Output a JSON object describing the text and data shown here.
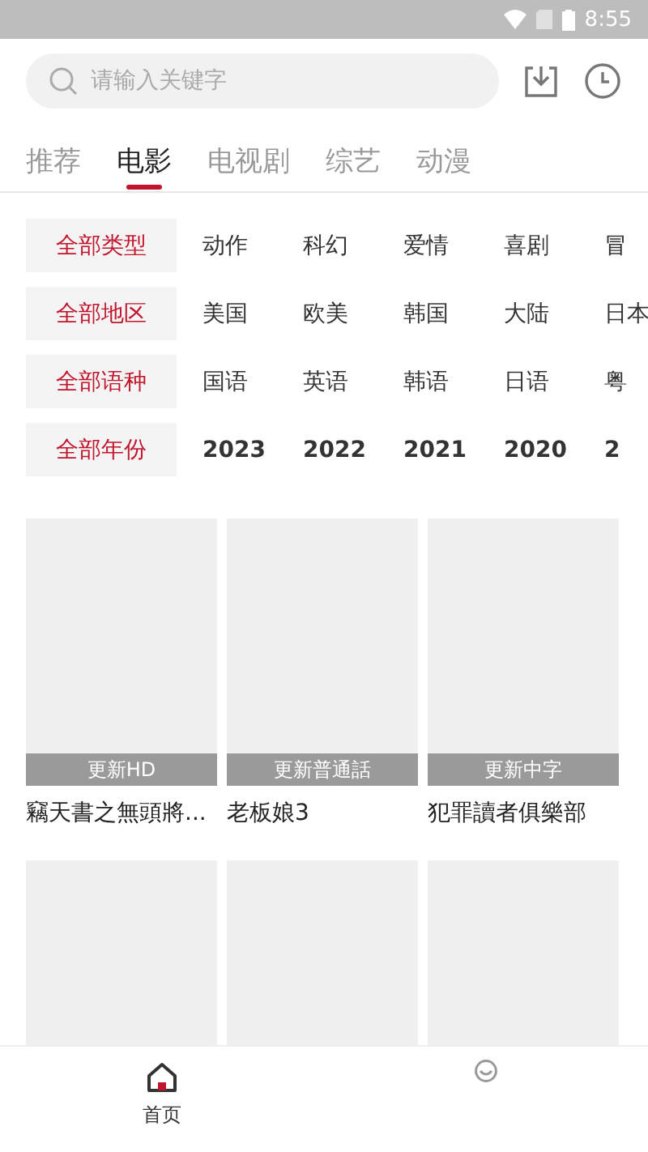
{
  "status_bar": {
    "time": "8:55"
  },
  "search": {
    "placeholder": "请输入关键字"
  },
  "tabs": [
    {
      "label": "推荐",
      "selected": false
    },
    {
      "label": "电影",
      "selected": true
    },
    {
      "label": "电视剧",
      "selected": false
    },
    {
      "label": "综艺",
      "selected": false
    },
    {
      "label": "动漫",
      "selected": false
    }
  ],
  "filters": [
    {
      "label": "全部类型",
      "options": [
        "动作",
        "科幻",
        "爱情",
        "喜剧",
        "冒"
      ]
    },
    {
      "label": "全部地区",
      "options": [
        "美国",
        "欧美",
        "韩国",
        "大陆",
        "日本"
      ]
    },
    {
      "label": "全部语种",
      "options": [
        "国语",
        "英语",
        "韩语",
        "日语",
        "粤"
      ]
    },
    {
      "label": "全部年份",
      "options": [
        "2023",
        "2022",
        "2021",
        "2020",
        "2"
      ]
    }
  ],
  "movies": [
    {
      "kind": "movie",
      "badge": "更新HD",
      "title": "竊天書之無頭將..."
    },
    {
      "kind": "movie",
      "badge": "更新普通話",
      "title": "老板娘3"
    },
    {
      "kind": "movie",
      "badge": "更新中字",
      "title": "犯罪讀者俱樂部"
    },
    {
      "kind": "poster"
    },
    {
      "kind": "poster"
    },
    {
      "kind": "poster"
    }
  ],
  "bottom_nav": [
    {
      "label": "首页",
      "kind": "home",
      "selected": true
    },
    {
      "kind": "profile",
      "selected": false
    }
  ]
}
